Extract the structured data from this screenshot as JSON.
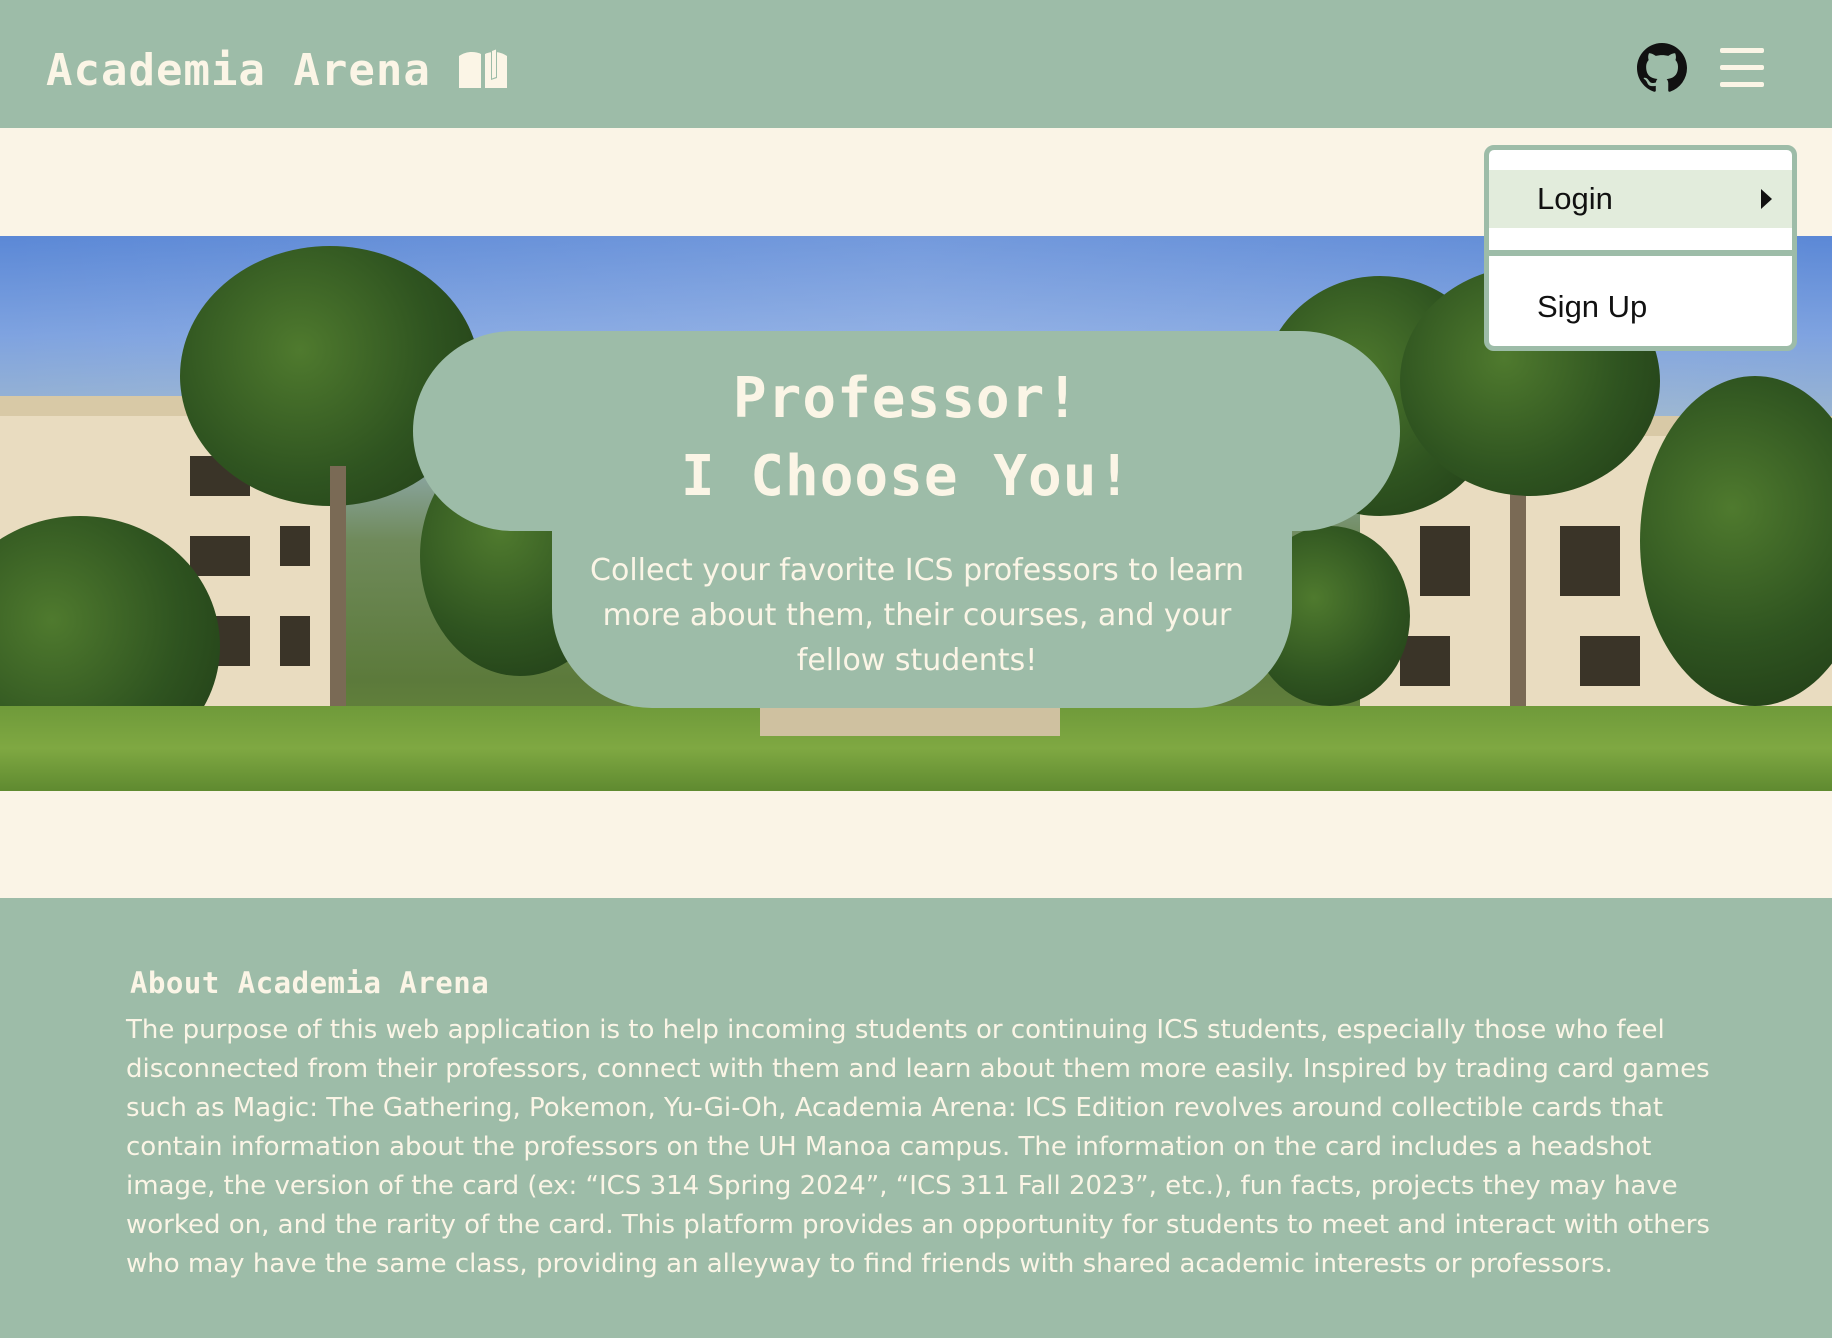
{
  "navbar": {
    "brand": "Academia Arena",
    "icons": [
      "book-icon",
      "github-icon",
      "hamburger-menu-icon"
    ]
  },
  "dropdown": {
    "items": [
      {
        "label": "Login",
        "icon": "caret-right-icon"
      },
      {
        "label": "Sign Up"
      }
    ]
  },
  "hero": {
    "title_line1": "Professor!",
    "title_line2": "I Choose You!",
    "subtitle": "Collect your favorite ICS professors to learn more about them, their courses, and your fellow students!"
  },
  "about": {
    "title": "About Academia Arena",
    "body": "The purpose of this web application is to help incoming students or continuing ICS students, especially those who feel disconnected from their professors, connect with them and learn about them more easily. Inspired by trading card games such as Magic: The Gathering, Pokemon, Yu-Gi-Oh, Academia Arena: ICS Edition revolves around collectible cards that contain information about the professors on the UH Manoa campus. The information on the card includes a headshot image, the version of the card (ex: “ICS 314 Spring 2024”, “ICS 311 Fall 2023”, etc.), fun facts, projects they may have worked on, and the rarity of the card. This platform provides an opportunity for students to meet and interact with others who may have the same class, providing an alleyway to find friends with shared academic interests or professors."
  },
  "colors": {
    "primary_green": "#9dbca8",
    "cream": "#faf4e6",
    "highlight": "#e2ecdc"
  }
}
